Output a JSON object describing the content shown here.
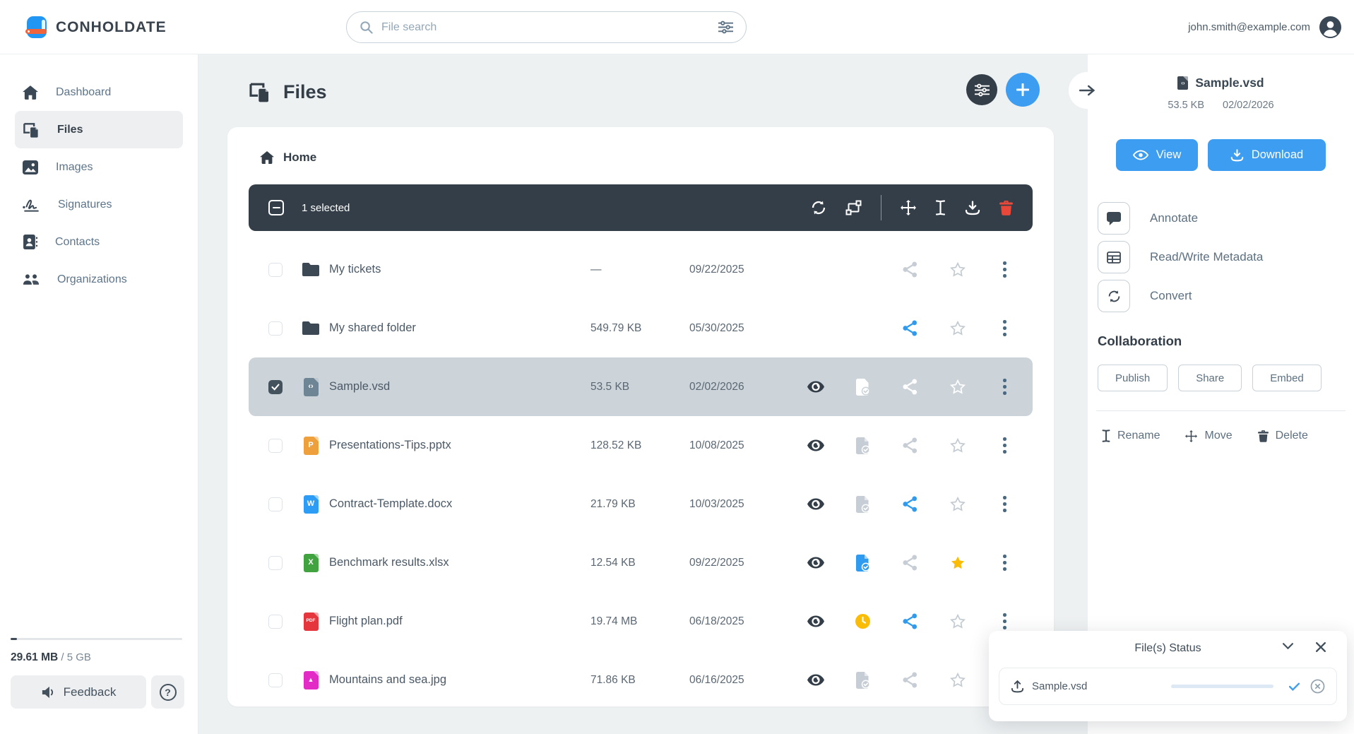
{
  "colors": {
    "accent_blue": "#3d9df0",
    "toolbar_dark": "#333e48",
    "selected_row_bg": "#ccd4da",
    "star_yellow": "#fbbc05",
    "delete_red": "#e8483a",
    "share_blue": "#2e9bf0",
    "icon_gray": "#c6cdd4"
  },
  "header": {
    "logo_text": "CONHOLDATE",
    "search_placeholder": "File search",
    "user_email": "john.smith@example.com"
  },
  "sidebar": {
    "items": [
      {
        "label": "Dashboard"
      },
      {
        "label": "Files"
      },
      {
        "label": "Images"
      },
      {
        "label": "Signatures"
      },
      {
        "label": "Contacts"
      },
      {
        "label": "Organizations"
      }
    ],
    "storage_used": "29.61 MB",
    "storage_total": " / 5 GB",
    "feedback_label": "Feedback",
    "help_label": "?"
  },
  "main": {
    "title": "Files",
    "breadcrumb_home": "Home",
    "selection_count": "1 selected",
    "files": [
      {
        "name": "My tickets",
        "type": "folder",
        "letter": "",
        "icon_color": "#3c4854",
        "size": "—",
        "date": "09/22/2025",
        "checked": false,
        "selected": false,
        "eye": false,
        "status": "none",
        "share": "gray",
        "star": "outline"
      },
      {
        "name": "My shared folder",
        "type": "folder",
        "letter": "",
        "icon_color": "#3c4854",
        "size": "549.79 KB",
        "date": "05/30/2025",
        "checked": false,
        "selected": false,
        "eye": false,
        "status": "none",
        "share": "blue",
        "star": "outline"
      },
      {
        "name": "Sample.vsd",
        "type": "file",
        "letter": "‹›",
        "icon_color": "#6e8596",
        "size": "53.5 KB",
        "date": "02/02/2026",
        "checked": true,
        "selected": true,
        "eye": true,
        "status": "check-white",
        "share": "white",
        "star": "outline-white"
      },
      {
        "name": "Presentations-Tips.pptx",
        "type": "file",
        "letter": "P",
        "icon_color": "#eda03c",
        "size": "128.52 KB",
        "date": "10/08/2025",
        "checked": false,
        "selected": false,
        "eye": true,
        "status": "check-gray",
        "share": "gray",
        "star": "outline"
      },
      {
        "name": "Contract-Template.docx",
        "type": "file",
        "letter": "W",
        "icon_color": "#2d9cf4",
        "size": "21.79 KB",
        "date": "10/03/2025",
        "checked": false,
        "selected": false,
        "eye": true,
        "status": "check-gray",
        "share": "blue",
        "star": "outline"
      },
      {
        "name": "Benchmark results.xlsx",
        "type": "file",
        "letter": "X",
        "icon_color": "#41a33f",
        "size": "12.54 KB",
        "date": "09/22/2025",
        "checked": false,
        "selected": false,
        "eye": true,
        "status": "check-blue",
        "share": "gray",
        "star": "yellow"
      },
      {
        "name": "Flight plan.pdf",
        "type": "file",
        "letter": "PDF",
        "icon_color": "#e5353d",
        "size": "19.74 MB",
        "date": "06/18/2025",
        "checked": false,
        "selected": false,
        "eye": true,
        "status": "clock",
        "share": "blue",
        "star": "outline"
      },
      {
        "name": "Mountains and sea.jpg",
        "type": "file",
        "letter": "▲",
        "icon_color": "#e32bc6",
        "size": "71.86 KB",
        "date": "06/16/2025",
        "checked": false,
        "selected": false,
        "eye": true,
        "status": "check-gray",
        "share": "gray",
        "star": "outline"
      }
    ]
  },
  "details": {
    "file_name": "Sample.vsd",
    "file_icon_letter": "‹›",
    "file_icon_color": "#3c4854",
    "file_size": "53.5 KB",
    "file_date": "02/02/2026",
    "view_label": "View",
    "download_label": "Download",
    "actions": [
      {
        "label": "Annotate"
      },
      {
        "label": "Read/Write Metadata"
      },
      {
        "label": "Convert"
      }
    ],
    "collaboration_title": "Collaboration",
    "collab_buttons": [
      {
        "label": "Publish"
      },
      {
        "label": "Share"
      },
      {
        "label": "Embed"
      }
    ],
    "file_ops": [
      {
        "label": "Rename"
      },
      {
        "label": "Move"
      },
      {
        "label": "Delete"
      }
    ]
  },
  "status_popup": {
    "title": "File(s) Status",
    "file_name": "Sample.vsd",
    "progress_percent": 100
  }
}
